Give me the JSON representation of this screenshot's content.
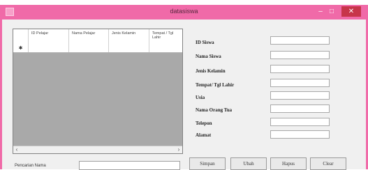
{
  "window": {
    "title": "datasiswa"
  },
  "title_controls": {
    "minimize": "–",
    "maximize": "□",
    "close": "✕"
  },
  "grid": {
    "columns": [
      "ID Pelajar",
      "Nama Pelajar",
      "Jenis Kelamin",
      "Tempat / Tgl Lahir"
    ],
    "new_row_marker": "✱",
    "scroll_left": "‹",
    "scroll_right": "›"
  },
  "search": {
    "label": "Pencarian Nama",
    "value": ""
  },
  "form": {
    "fields": [
      {
        "label": "ID Siswa",
        "value": ""
      },
      {
        "label": "Nama Siswa",
        "value": ""
      },
      {
        "label": "Jenis Kelamin",
        "value": ""
      },
      {
        "label": "Tempat/ Tgl Lahir",
        "value": ""
      },
      {
        "label": "Usia",
        "value": ""
      },
      {
        "label": "Nama Orang Tua",
        "value": ""
      },
      {
        "label": "Telepon",
        "value": ""
      },
      {
        "label": "Alamat",
        "value": ""
      }
    ]
  },
  "buttons": {
    "save": "Simpan",
    "edit": "Ubah",
    "delete": "Hapus",
    "clear": "Clear"
  },
  "colors": {
    "titlebar": "#f06aa8",
    "close": "#c7354a"
  }
}
